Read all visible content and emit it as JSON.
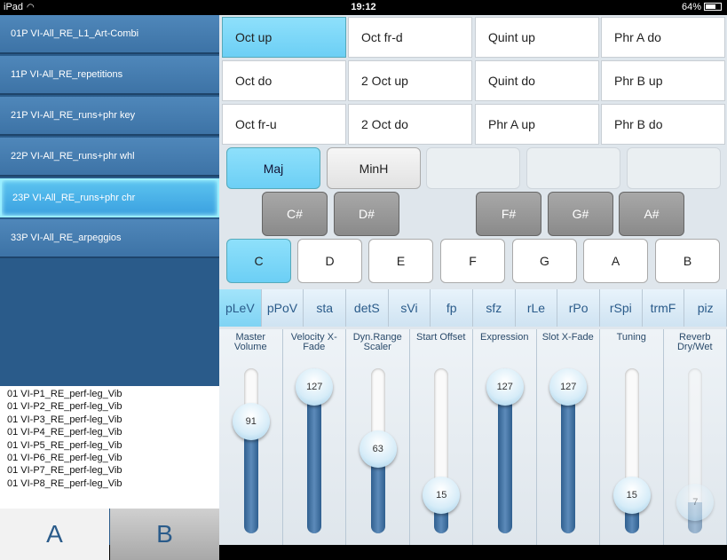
{
  "status": {
    "device": "iPad",
    "time": "19:12",
    "battery": "64%"
  },
  "presets": [
    "01P VI-All_RE_L1_Art-Combi",
    "11P VI-All_RE_repetitions",
    "21P VI-All_RE_runs+phr key",
    "22P VI-All_RE_runs+phr whl",
    "23P VI-All_RE_runs+phr chr",
    "33P VI-All_RE_arpeggios"
  ],
  "selected_preset": 4,
  "patches": [
    "01 VI-P1_RE_perf-leg_Vib",
    "01 VI-P2_RE_perf-leg_Vib",
    "01 VI-P3_RE_perf-leg_Vib",
    "01 VI-P4_RE_perf-leg_Vib",
    "01 VI-P5_RE_perf-leg_Vib",
    "01 VI-P6_RE_perf-leg_Vib",
    "01 VI-P7_RE_perf-leg_Vib",
    "01 VI-P8_RE_perf-leg_Vib"
  ],
  "ab": {
    "a": "A",
    "b": "B"
  },
  "grid": [
    [
      "Oct up",
      "Oct fr-d",
      "Quint up",
      "Phr A do"
    ],
    [
      "Oct do",
      "2 Oct up",
      "Quint do",
      "Phr B up"
    ],
    [
      "Oct fr-u",
      "2 Oct do",
      "Phr A up",
      "Phr B do"
    ]
  ],
  "scales": [
    "Maj",
    "MinH"
  ],
  "black_keys": [
    "C#",
    "D#",
    "F#",
    "G#",
    "A#"
  ],
  "white_keys": [
    "C",
    "D",
    "E",
    "F",
    "G",
    "A",
    "B"
  ],
  "artics": [
    {
      "label": "pLeV",
      "color": "#e05050"
    },
    {
      "label": "pPoV",
      "color": "#e09030"
    },
    {
      "label": "sta",
      "color": "#d8c030"
    },
    {
      "label": "detS",
      "color": "#70c030"
    },
    {
      "label": "sVi",
      "color": "#30b040"
    },
    {
      "label": "fp",
      "color": "#20b070"
    },
    {
      "label": "sfz",
      "color": "#20b0b0"
    },
    {
      "label": "rLe",
      "color": "#40c0d0"
    },
    {
      "label": "rPo",
      "color": "#40a0e0"
    },
    {
      "label": "rSpi",
      "color": "#3070d0"
    },
    {
      "label": "trmF",
      "color": "#5050c0"
    },
    {
      "label": "piz",
      "color": "#9050c0"
    }
  ],
  "faders": [
    {
      "label": "Master Volume",
      "value": 91
    },
    {
      "label": "Velocity X-Fade",
      "value": 127
    },
    {
      "label": "Dyn.Range Scaler",
      "value": 63
    },
    {
      "label": "Start Offset",
      "value": 15
    },
    {
      "label": "Expression",
      "value": 127
    },
    {
      "label": "Slot X-Fade",
      "value": 127
    },
    {
      "label": "Tuning",
      "value": 15
    },
    {
      "label": "Reverb Dry/Wet",
      "value": 7
    }
  ]
}
